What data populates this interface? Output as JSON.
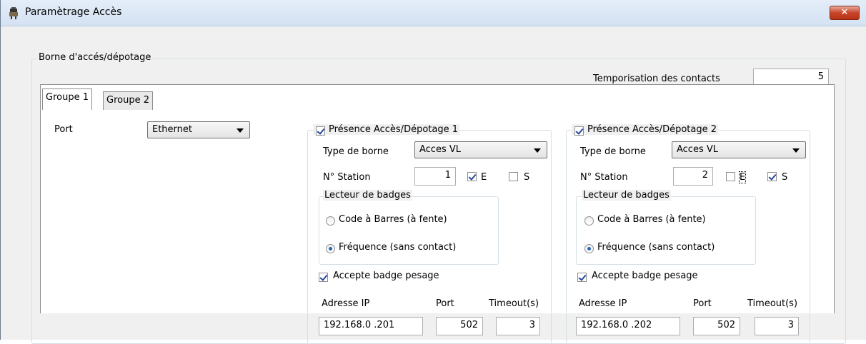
{
  "window": {
    "title": "Paramètrage Accès",
    "close_label": "✕"
  },
  "borne_group": {
    "legend": "Borne d'accés/dépotage"
  },
  "temporisation": {
    "label": "Temporisation des contacts",
    "value": "5"
  },
  "tabs": [
    {
      "label": "Groupe 1",
      "selected": true
    },
    {
      "label": "Groupe 2",
      "selected": false
    }
  ],
  "port": {
    "label": "Port",
    "value": "Ethernet"
  },
  "presence": [
    {
      "label": "Présence Accès/Dépotage 1",
      "checked": true,
      "type_label": "Type de borne",
      "type_value": "Acces VL",
      "station_label": "N° Station",
      "station_value": "1",
      "e_label": "E",
      "e_checked": true,
      "s_label": "S",
      "s_checked": false,
      "lecteur_label": "Lecteur de badges",
      "radio_barcode": "Code à Barres (à fente)",
      "radio_freq": "Fréquence (sans contact)",
      "selected": "freq",
      "accept_label": "Accepte badge pesage",
      "accept_checked": true,
      "ip_label": "Adresse IP",
      "port_label": "Port",
      "timeout_label": "Timeout(s)",
      "ip_value": "192.168.0 .201",
      "port_value": "502",
      "timeout_value": "3"
    },
    {
      "label": "Présence Accès/Dépotage 2",
      "checked": true,
      "type_label": "Type de borne",
      "type_value": "Acces VL",
      "station_label": "N° Station",
      "station_value": "2",
      "e_label": "E",
      "e_checked": false,
      "s_label": "S",
      "s_checked": true,
      "lecteur_label": "Lecteur de badges",
      "radio_barcode": "Code à Barres (à fente)",
      "radio_freq": "Fréquence (sans contact)",
      "selected": "freq",
      "accept_label": "Accepte badge pesage",
      "accept_checked": true,
      "ip_label": "Adresse IP",
      "port_label": "Port",
      "timeout_label": "Timeout(s)",
      "ip_value": "192.168.0 .202",
      "port_value": "502",
      "timeout_value": "3"
    }
  ]
}
